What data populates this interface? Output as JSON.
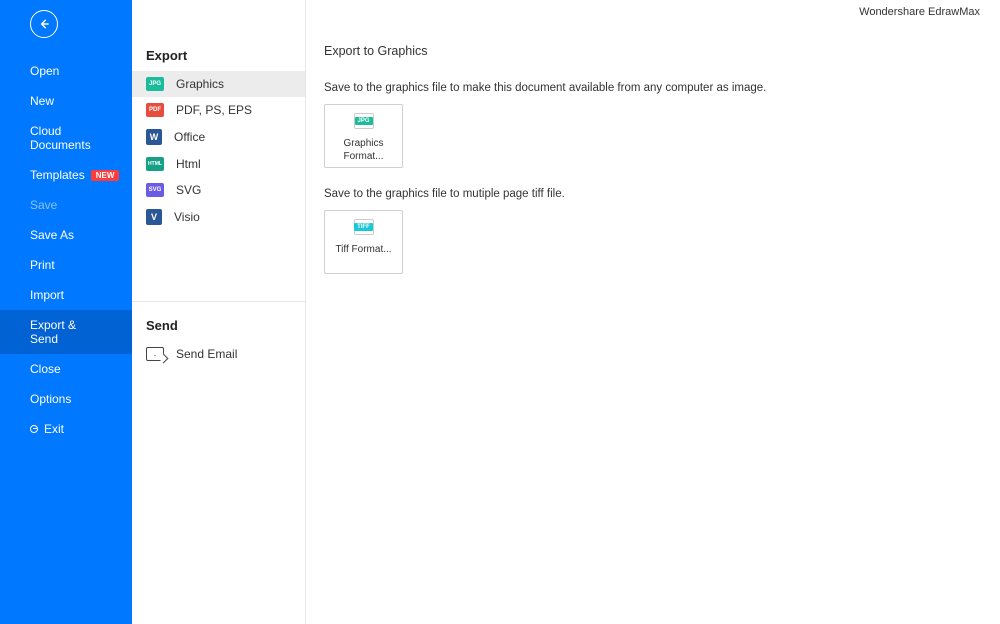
{
  "app_title": "Wondershare EdrawMax",
  "sidebar": {
    "items": [
      {
        "label": "Open"
      },
      {
        "label": "New"
      },
      {
        "label": "Cloud Documents"
      },
      {
        "label": "Templates",
        "badge": "NEW"
      },
      {
        "label": "Save"
      },
      {
        "label": "Save As"
      },
      {
        "label": "Print"
      },
      {
        "label": "Import"
      },
      {
        "label": "Export & Send"
      },
      {
        "label": "Close"
      },
      {
        "label": "Options"
      },
      {
        "label": "Exit"
      }
    ]
  },
  "export": {
    "header": "Export",
    "items": [
      {
        "label": "Graphics",
        "tag": "JPG",
        "color": "#1abc9c"
      },
      {
        "label": "PDF, PS, EPS",
        "tag": "PDF",
        "color": "#e74c3c"
      },
      {
        "label": "Office",
        "tag": "W",
        "color": "#2b5797"
      },
      {
        "label": "Html",
        "tag": "HTML",
        "color": "#16a085"
      },
      {
        "label": "SVG",
        "tag": "SVG",
        "color": "#6b5ce4"
      },
      {
        "label": "Visio",
        "tag": "V",
        "color": "#2b5797"
      }
    ]
  },
  "send": {
    "header": "Send",
    "items": [
      {
        "label": "Send Email"
      }
    ]
  },
  "panel": {
    "title": "Export to Graphics",
    "desc1": "Save to the graphics file to make this document available from any computer as image.",
    "card1": {
      "label": "Graphics Format...",
      "tag": "JPG",
      "tagcolor": "#1abc9c"
    },
    "desc2": "Save to the graphics file to mutiple page tiff file.",
    "card2": {
      "label": "Tiff Format...",
      "tag": "TIFF",
      "tagcolor": "#17c9d6"
    }
  }
}
